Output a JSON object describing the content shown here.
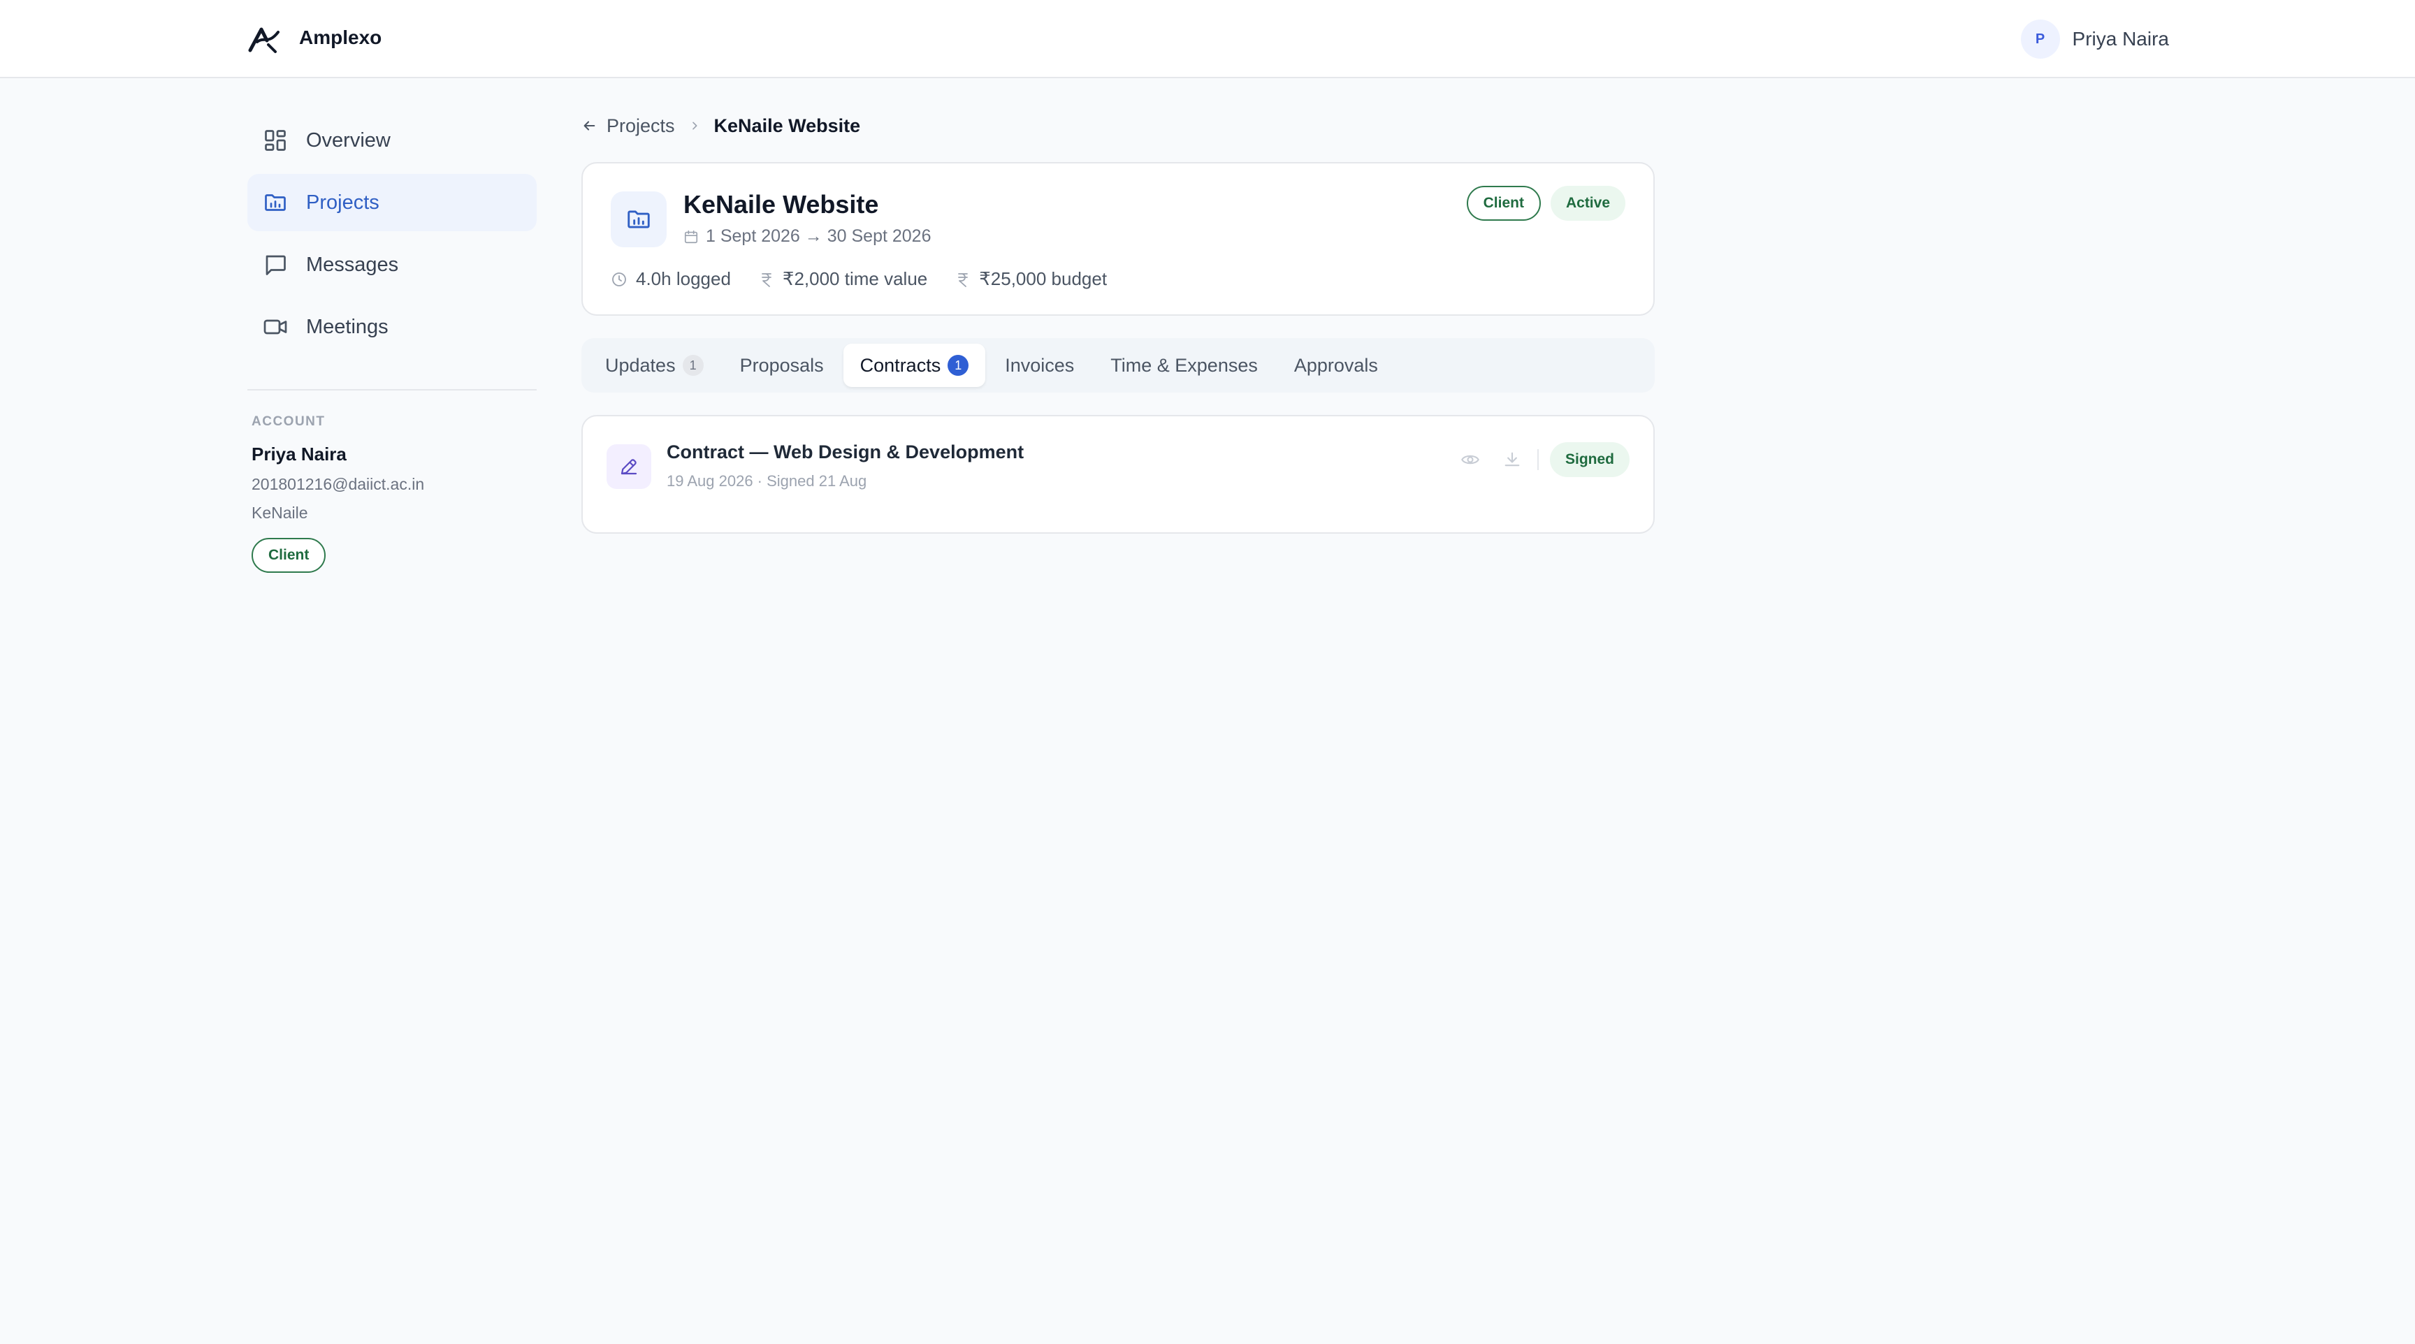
{
  "app": {
    "brand": "Amplexo",
    "accent": "#2f5fd4"
  },
  "user": {
    "initial": "P",
    "name": "Priya Naira"
  },
  "sidebar": {
    "items": [
      {
        "label": "Overview",
        "icon": "grid-icon",
        "active": false
      },
      {
        "label": "Projects",
        "icon": "folder-chart-icon",
        "active": true
      },
      {
        "label": "Messages",
        "icon": "message-icon",
        "active": false
      },
      {
        "label": "Meetings",
        "icon": "video-icon",
        "active": false
      }
    ],
    "account": {
      "label": "ACCOUNT",
      "name": "Priya Naira",
      "email": "201801216@daiict.ac.in",
      "org": "KeNaile",
      "role": "Client"
    }
  },
  "breadcrumb": {
    "back": "Projects",
    "current": "KeNaile Website"
  },
  "project": {
    "title": "KeNaile Website",
    "dates": "1 Sept 2026 → 30 Sept 2026",
    "badges": {
      "role": "Client",
      "status": "Active"
    },
    "stats": {
      "logged": "4.0h logged",
      "time_value": "₹2,000 time value",
      "budget": "₹25,000 budget"
    }
  },
  "tabs": [
    {
      "label": "Updates",
      "count": "1",
      "active": false
    },
    {
      "label": "Proposals",
      "count": null,
      "active": false
    },
    {
      "label": "Contracts",
      "count": "1",
      "active": true
    },
    {
      "label": "Invoices",
      "count": null,
      "active": false
    },
    {
      "label": "Time & Expenses",
      "count": null,
      "active": false
    },
    {
      "label": "Approvals",
      "count": null,
      "active": false
    }
  ],
  "contracts": [
    {
      "title": "Contract — Web Design & Development",
      "meta": "19 Aug 2026 · Signed 21 Aug",
      "status": "Signed"
    }
  ]
}
